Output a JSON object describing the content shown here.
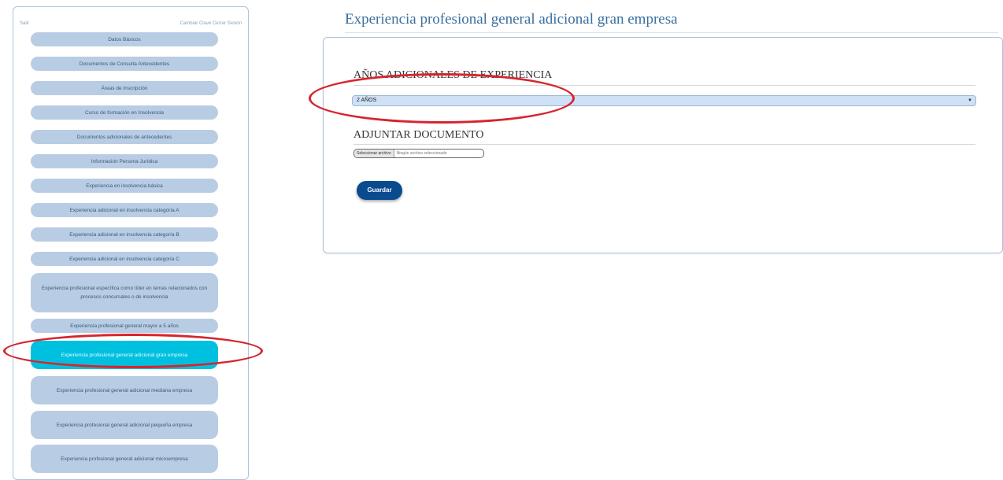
{
  "sidebar": {
    "top_left": "Salir",
    "top_right": "Cambiar Clave  Cerrar Sesión",
    "items": [
      {
        "label": "Datos Básicos"
      },
      {
        "label": "Documentos de Consulta Antecedentes"
      },
      {
        "label": "Áreas de Inscripción"
      },
      {
        "label": "Curso de formación en Insolvencia"
      },
      {
        "label": "Documentos adicionales de antecedentes"
      },
      {
        "label": "Información Persona Jurídica"
      },
      {
        "label": "Experiencia en insolvencia básica"
      },
      {
        "label": "Experiencia adicional en insolvencia categoría A"
      },
      {
        "label": "Experiencia adicional en insolvencia categoría B"
      },
      {
        "label": "Experiencia adicional en insolvencia categoría C"
      },
      {
        "label": "Experiencia profesional específica como líder en temas relacionados con procesos concursales o de insolvencia"
      },
      {
        "label": "Experiencia profesional general mayor a 5 años"
      },
      {
        "label": "Experiencia profesional general adicional gran empresa"
      },
      {
        "label": "Experiencia profesional general adicional mediana empresa"
      },
      {
        "label": "Experiencia profesional general adicional pequeña empresa"
      },
      {
        "label": "Experiencia profesional general adicional microempresa"
      }
    ],
    "active_index": 12
  },
  "main": {
    "title": "Experiencia profesional general adicional gran empresa",
    "years_label": "AÑOS ADICIONALES DE EXPERIENCIA",
    "years_value": "2 AÑOS",
    "attach_label": "ADJUNTAR DOCUMENTO",
    "file_button": "Seleccionar archivo",
    "file_status": "Ningún archivo seleccionado",
    "save_label": "Guardar"
  },
  "colors": {
    "menu_item": "#b8cce4",
    "menu_active": "#00c0e0",
    "save_button": "#0a4a8f",
    "highlight_oval": "#d6252e"
  }
}
